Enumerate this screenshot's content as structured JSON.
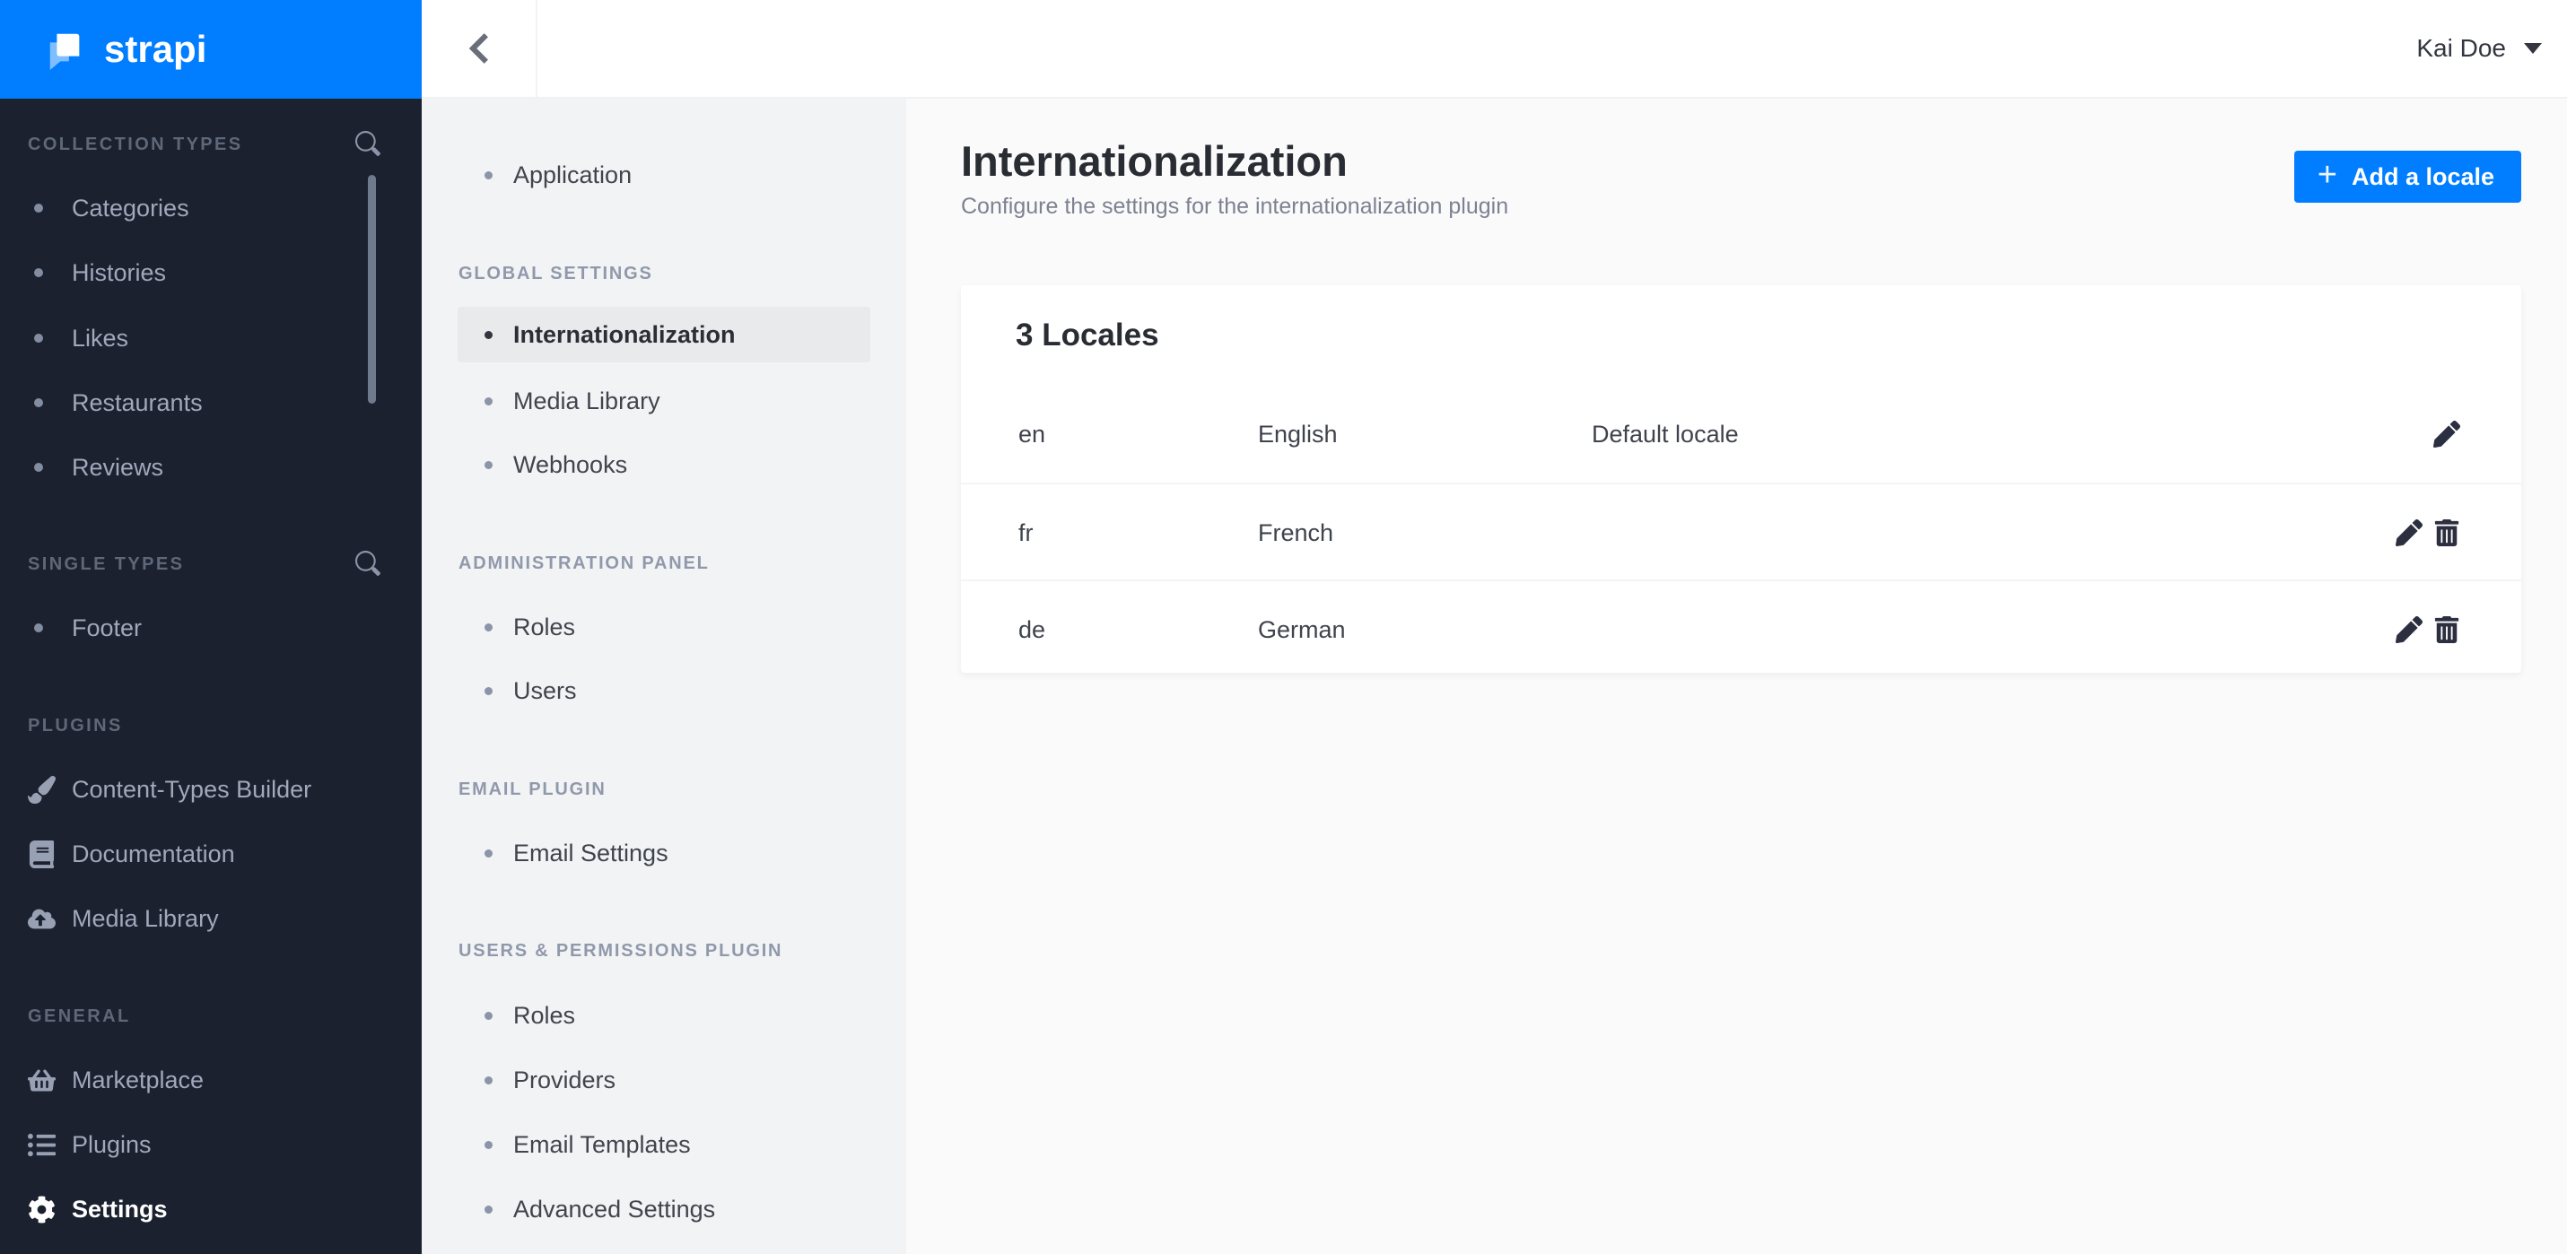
{
  "brand": {
    "name": "strapi",
    "accent_color": "#007eff",
    "sidebar_bg": "#1b212f"
  },
  "topbar": {
    "user_name": "Kai Doe",
    "back_icon": "chevron-left-icon",
    "caret_icon": "caret-down-icon"
  },
  "sidebar": {
    "sections": [
      {
        "title": "COLLECTION TYPES",
        "search_icon": "search-icon",
        "items": [
          {
            "label": "Categories"
          },
          {
            "label": "Histories"
          },
          {
            "label": "Likes"
          },
          {
            "label": "Restaurants"
          },
          {
            "label": "Reviews"
          }
        ]
      },
      {
        "title": "SINGLE TYPES",
        "search_icon": "search-icon",
        "items": [
          {
            "label": "Footer"
          }
        ]
      },
      {
        "title": "PLUGINS",
        "items": [
          {
            "label": "Content-Types Builder",
            "icon": "paintbrush-icon"
          },
          {
            "label": "Documentation",
            "icon": "book-icon"
          },
          {
            "label": "Media Library",
            "icon": "cloud-upload-icon"
          }
        ]
      },
      {
        "title": "GENERAL",
        "items": [
          {
            "label": "Marketplace",
            "icon": "basket-icon"
          },
          {
            "label": "Plugins",
            "icon": "list-icon"
          },
          {
            "label": "Settings",
            "icon": "gear-icon",
            "active": true
          }
        ]
      }
    ]
  },
  "settings_nav": {
    "top_items": [
      {
        "label": "Application"
      }
    ],
    "sections": [
      {
        "title": "GLOBAL SETTINGS",
        "items": [
          {
            "label": "Internationalization",
            "active": true
          },
          {
            "label": "Media Library"
          },
          {
            "label": "Webhooks"
          }
        ]
      },
      {
        "title": "ADMINISTRATION PANEL",
        "items": [
          {
            "label": "Roles"
          },
          {
            "label": "Users"
          }
        ]
      },
      {
        "title": "EMAIL PLUGIN",
        "items": [
          {
            "label": "Email Settings"
          }
        ]
      },
      {
        "title": "USERS & PERMISSIONS PLUGIN",
        "items": [
          {
            "label": "Roles"
          },
          {
            "label": "Providers"
          },
          {
            "label": "Email Templates"
          },
          {
            "label": "Advanced Settings"
          }
        ]
      }
    ]
  },
  "main": {
    "title": "Internationalization",
    "subtitle": "Configure the settings for the internationalization plugin",
    "add_button": {
      "plus": "+",
      "label": "Add a locale"
    },
    "card": {
      "title": "3 Locales",
      "rows": [
        {
          "code": "en",
          "name": "English",
          "badge": "Default locale"
        },
        {
          "code": "fr",
          "name": "French",
          "badge": ""
        },
        {
          "code": "de",
          "name": "German",
          "badge": ""
        }
      ]
    }
  }
}
